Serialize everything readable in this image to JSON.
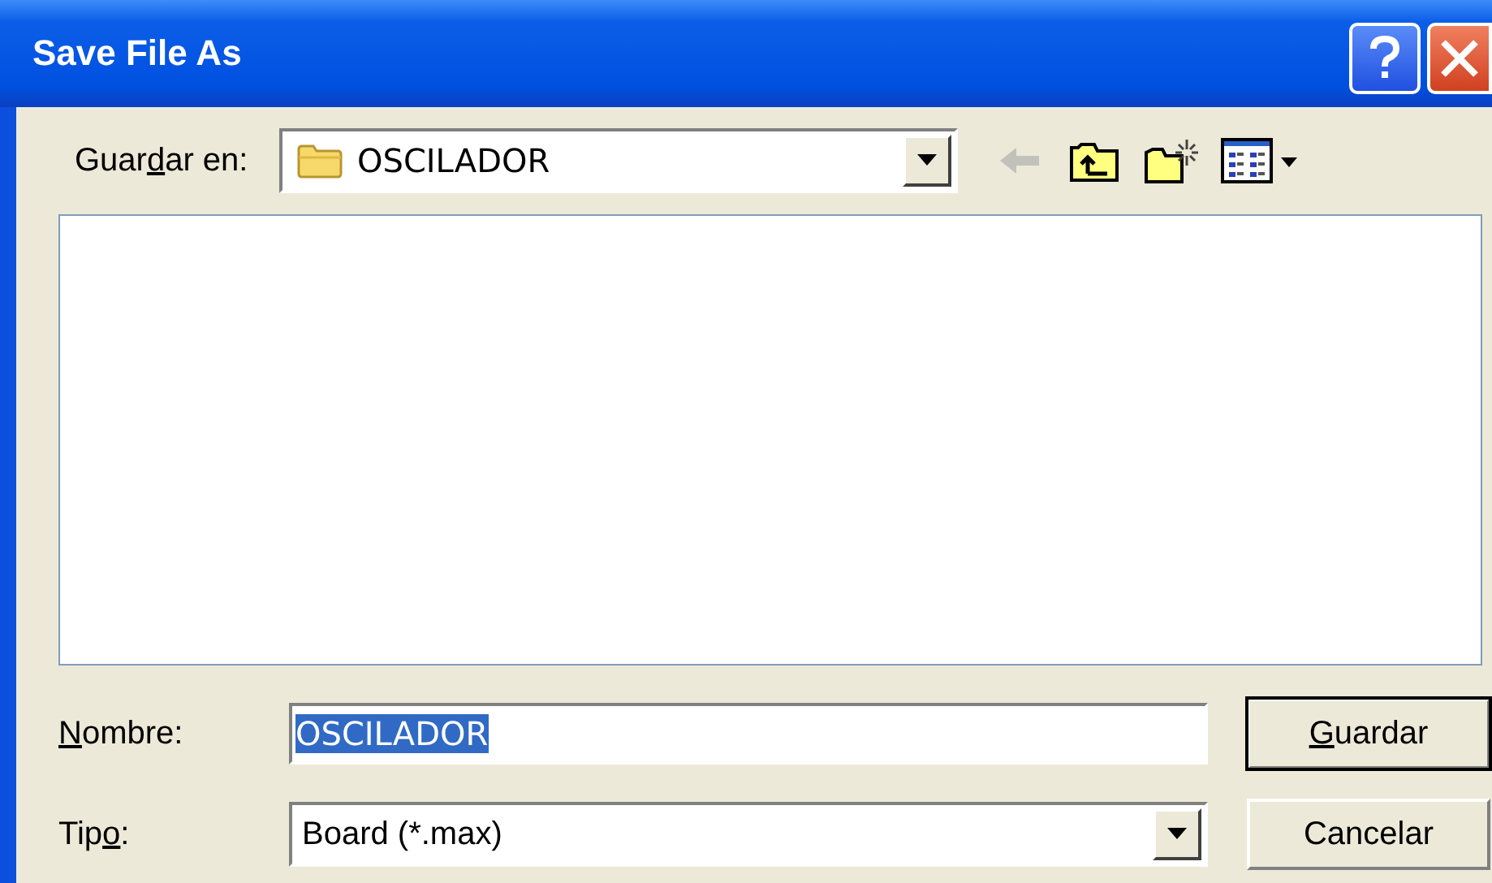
{
  "window": {
    "title": "Save File As"
  },
  "look_in": {
    "label_parts": [
      {
        "text": "Guar",
        "underline": false
      },
      {
        "text": "d",
        "underline": true
      },
      {
        "text": "ar en:",
        "underline": false
      }
    ],
    "value": "OSCILADOR"
  },
  "toolbar": [
    {
      "kind": "back",
      "disabled": true
    },
    {
      "kind": "up",
      "disabled": false
    },
    {
      "kind": "new_folder",
      "disabled": false
    },
    {
      "kind": "view",
      "disabled": false
    }
  ],
  "file_name": {
    "label_parts": [
      {
        "text": "N",
        "underline": true
      },
      {
        "text": "ombre:",
        "underline": false
      }
    ],
    "value": "OSCILADOR",
    "selected": true
  },
  "file_type": {
    "label_parts": [
      {
        "text": "Tip",
        "underline": false
      },
      {
        "text": "o",
        "underline": true
      },
      {
        "text": ":",
        "underline": false
      }
    ],
    "value": "Board (*.max)"
  },
  "buttons": [
    {
      "label_parts": [
        {
          "text": "G",
          "underline": true
        },
        {
          "text": "uardar",
          "underline": false
        }
      ],
      "default": true
    },
    {
      "label_parts": [
        {
          "text": "Cancelar",
          "underline": false
        }
      ],
      "default": false
    }
  ]
}
